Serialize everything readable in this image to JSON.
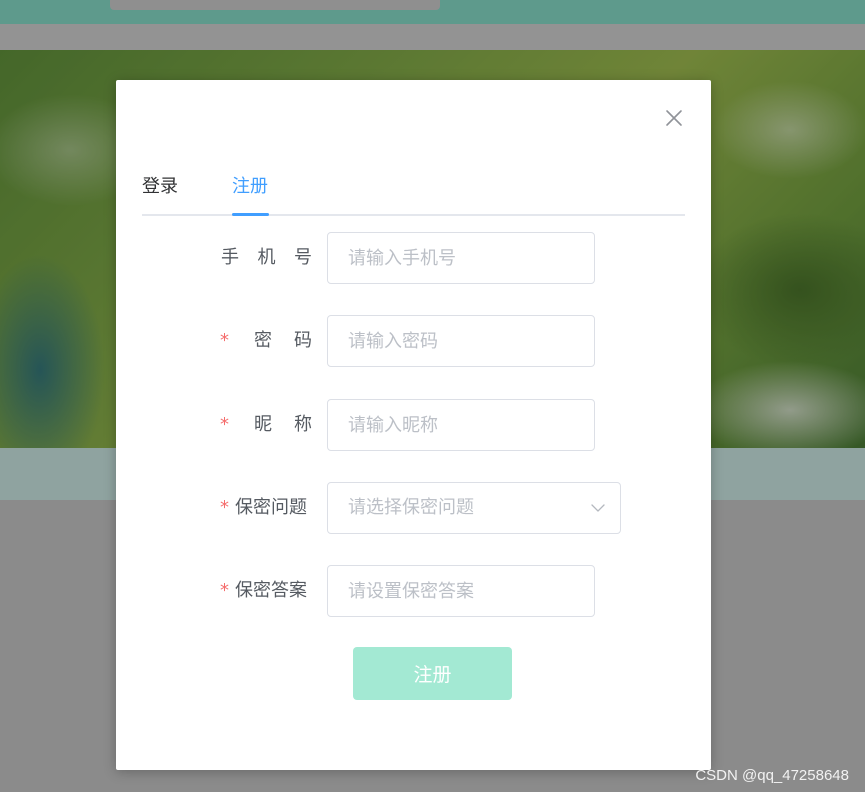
{
  "dialog": {
    "close_icon": "close-icon",
    "tabs": [
      {
        "label": "登录",
        "active": false
      },
      {
        "label": "注册",
        "active": true
      }
    ],
    "accent_color": "#409eff",
    "required_mark": "*",
    "fields": {
      "phone": {
        "label_chars": [
          "手",
          "机",
          "号"
        ],
        "placeholder": "请输入手机号",
        "required": false
      },
      "password": {
        "label_chars": [
          "密",
          "码"
        ],
        "placeholder": "请输入密码",
        "required": true
      },
      "nickname": {
        "label_chars": [
          "昵",
          "称"
        ],
        "placeholder": "请输入昵称",
        "required": true
      },
      "security_question": {
        "label": "保密问题",
        "placeholder": "请选择保密问题",
        "required": true,
        "icon": "chevron-down-icon"
      },
      "security_answer": {
        "label": "保密答案",
        "placeholder": "请设置保密答案",
        "required": true
      }
    },
    "submit": {
      "label": "注册",
      "color": "#a3e9d3"
    }
  },
  "watermark": "CSDN @qq_47258648"
}
